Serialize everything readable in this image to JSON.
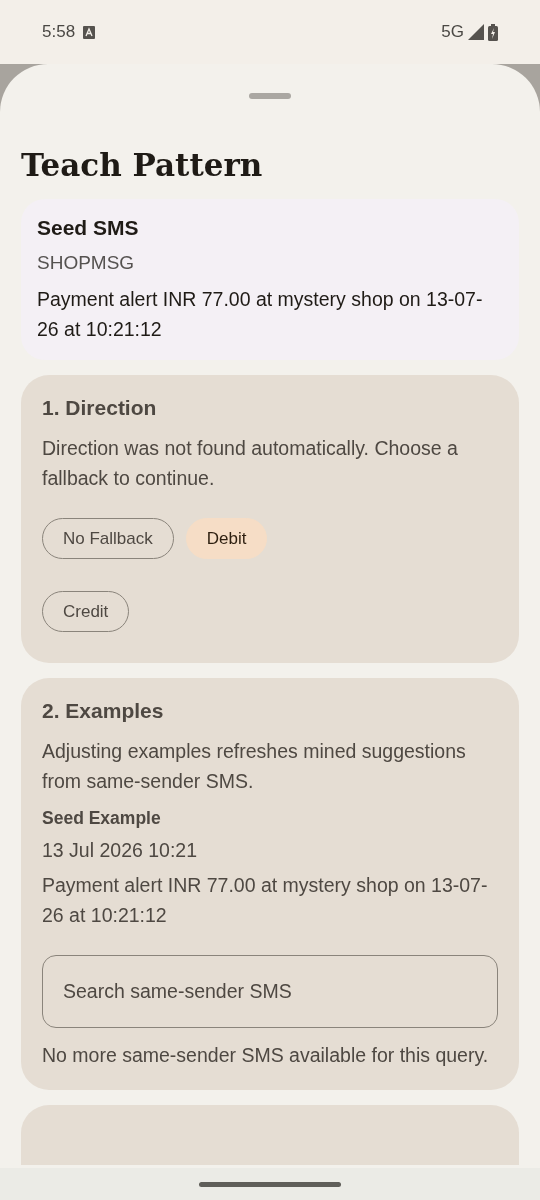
{
  "status_bar": {
    "time": "5:58",
    "network": "5G"
  },
  "sheet": {
    "title": "Teach Pattern",
    "seed_sms": {
      "title": "Seed SMS",
      "sender": "SHOPMSG",
      "body": "Payment alert INR 77.00 at mystery shop on 13-07-26 at 10:21:12"
    },
    "direction": {
      "title": "1. Direction",
      "description": "Direction was not found automatically. Choose a fallback to continue.",
      "options": [
        {
          "label": "No Fallback",
          "selected": false
        },
        {
          "label": "Debit",
          "selected": true
        },
        {
          "label": "Credit",
          "selected": false
        }
      ]
    },
    "examples": {
      "title": "2. Examples",
      "description": "Adjusting examples refreshes mined suggestions from same-sender SMS.",
      "seed_label": "Seed Example",
      "seed_date": "13 Jul 2026 10:21",
      "seed_body": "Payment alert INR 77.00 at mystery shop on 13-07-26 at 10:21:12",
      "search": {
        "placeholder": "Search same-sender SMS"
      },
      "empty_note": "No more same-sender SMS available for this query."
    }
  }
}
